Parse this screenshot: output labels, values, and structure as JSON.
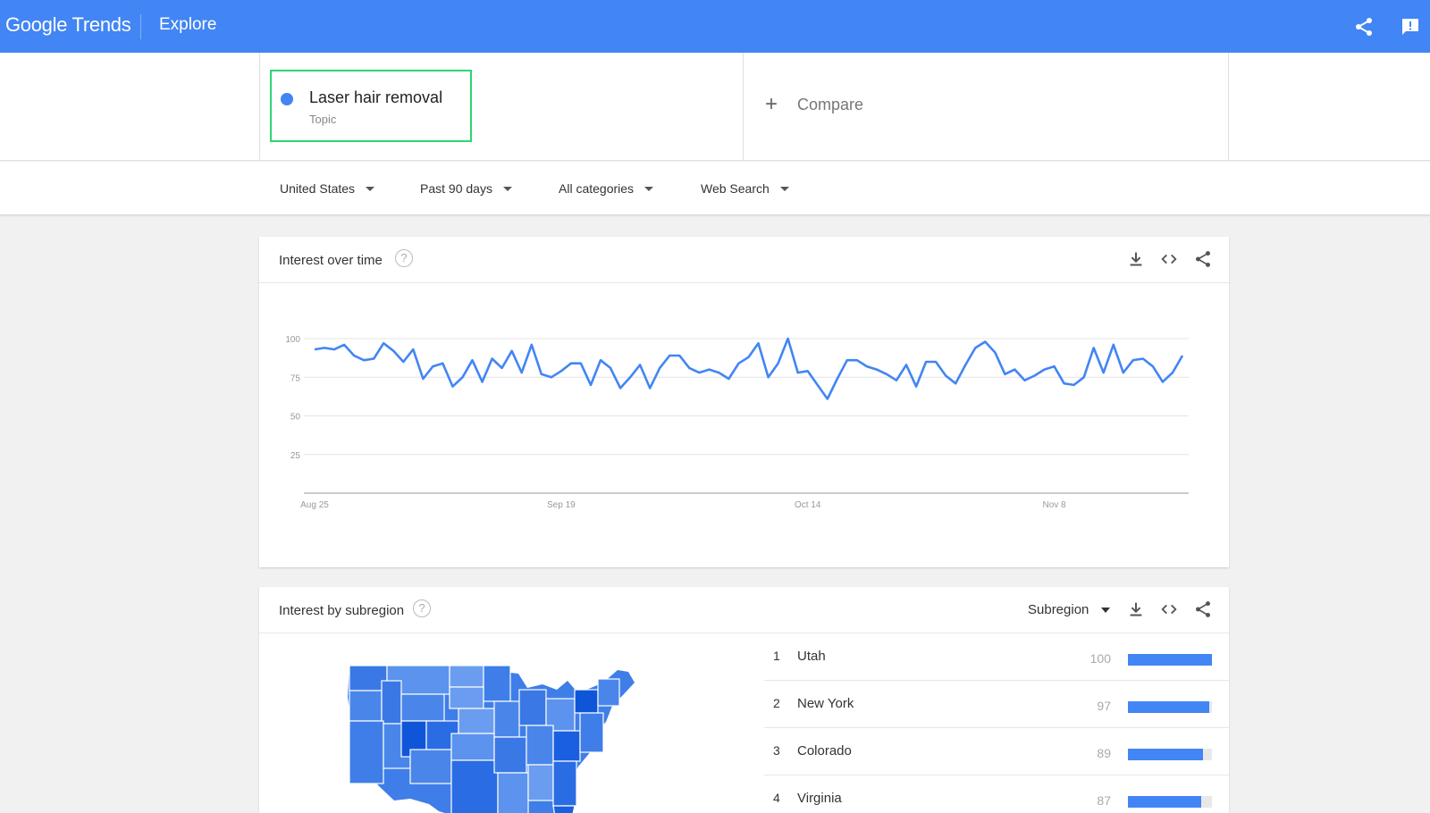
{
  "header": {
    "logo": "Google Trends",
    "page_title": "Explore",
    "share_icon": "share-icon",
    "feedback_icon": "feedback-icon",
    "bg_color": "#4285f4"
  },
  "search": {
    "term_name": "Laser hair removal",
    "term_type": "Topic",
    "term_color": "#4285f4",
    "compare_label": "Compare"
  },
  "filters": [
    {
      "label": "United States"
    },
    {
      "label": "Past 90 days"
    },
    {
      "label": "All categories"
    },
    {
      "label": "Web Search"
    }
  ],
  "interest_over_time": {
    "title": "Interest over time",
    "help": "?",
    "chart_data": {
      "type": "line",
      "title": "",
      "xlabel": "",
      "ylabel": "",
      "ylim": [
        0,
        100
      ],
      "yticks": [
        25,
        50,
        75,
        100
      ],
      "xticks": [
        "Aug 25",
        "Sep 19",
        "Oct 14",
        "Nov 8"
      ],
      "grid": true,
      "color": "#4285f4",
      "series": [
        {
          "values": [
            93,
            94,
            93,
            96,
            89,
            86,
            87,
            97,
            92,
            85,
            93,
            74,
            82,
            84,
            69,
            75,
            86,
            72,
            87,
            81,
            92,
            78,
            96,
            77,
            75,
            79,
            84,
            84,
            70,
            86,
            81,
            68,
            75,
            83,
            68,
            81,
            89,
            89,
            81,
            78,
            80,
            78,
            74,
            84,
            88,
            97,
            75,
            84,
            100,
            78,
            79,
            70,
            61,
            74,
            86,
            86,
            82,
            80,
            77,
            73,
            83,
            69,
            85,
            85,
            76,
            71,
            83,
            94,
            98,
            91,
            77,
            80,
            73,
            76,
            80,
            82,
            71,
            70,
            75,
            94,
            78,
            96,
            78,
            86,
            87,
            82,
            72,
            78,
            89
          ]
        }
      ]
    }
  },
  "interest_by_subregion": {
    "title": "Interest by subregion",
    "help": "?",
    "dropdown": "Subregion",
    "rows": [
      {
        "rank": "1",
        "name": "Utah",
        "value": "100",
        "fraction": 1.0
      },
      {
        "rank": "2",
        "name": "New York",
        "value": "97",
        "fraction": 0.97
      },
      {
        "rank": "3",
        "name": "Colorado",
        "value": "89",
        "fraction": 0.89
      },
      {
        "rank": "4",
        "name": "Virginia",
        "value": "87",
        "fraction": 0.87
      }
    ]
  }
}
